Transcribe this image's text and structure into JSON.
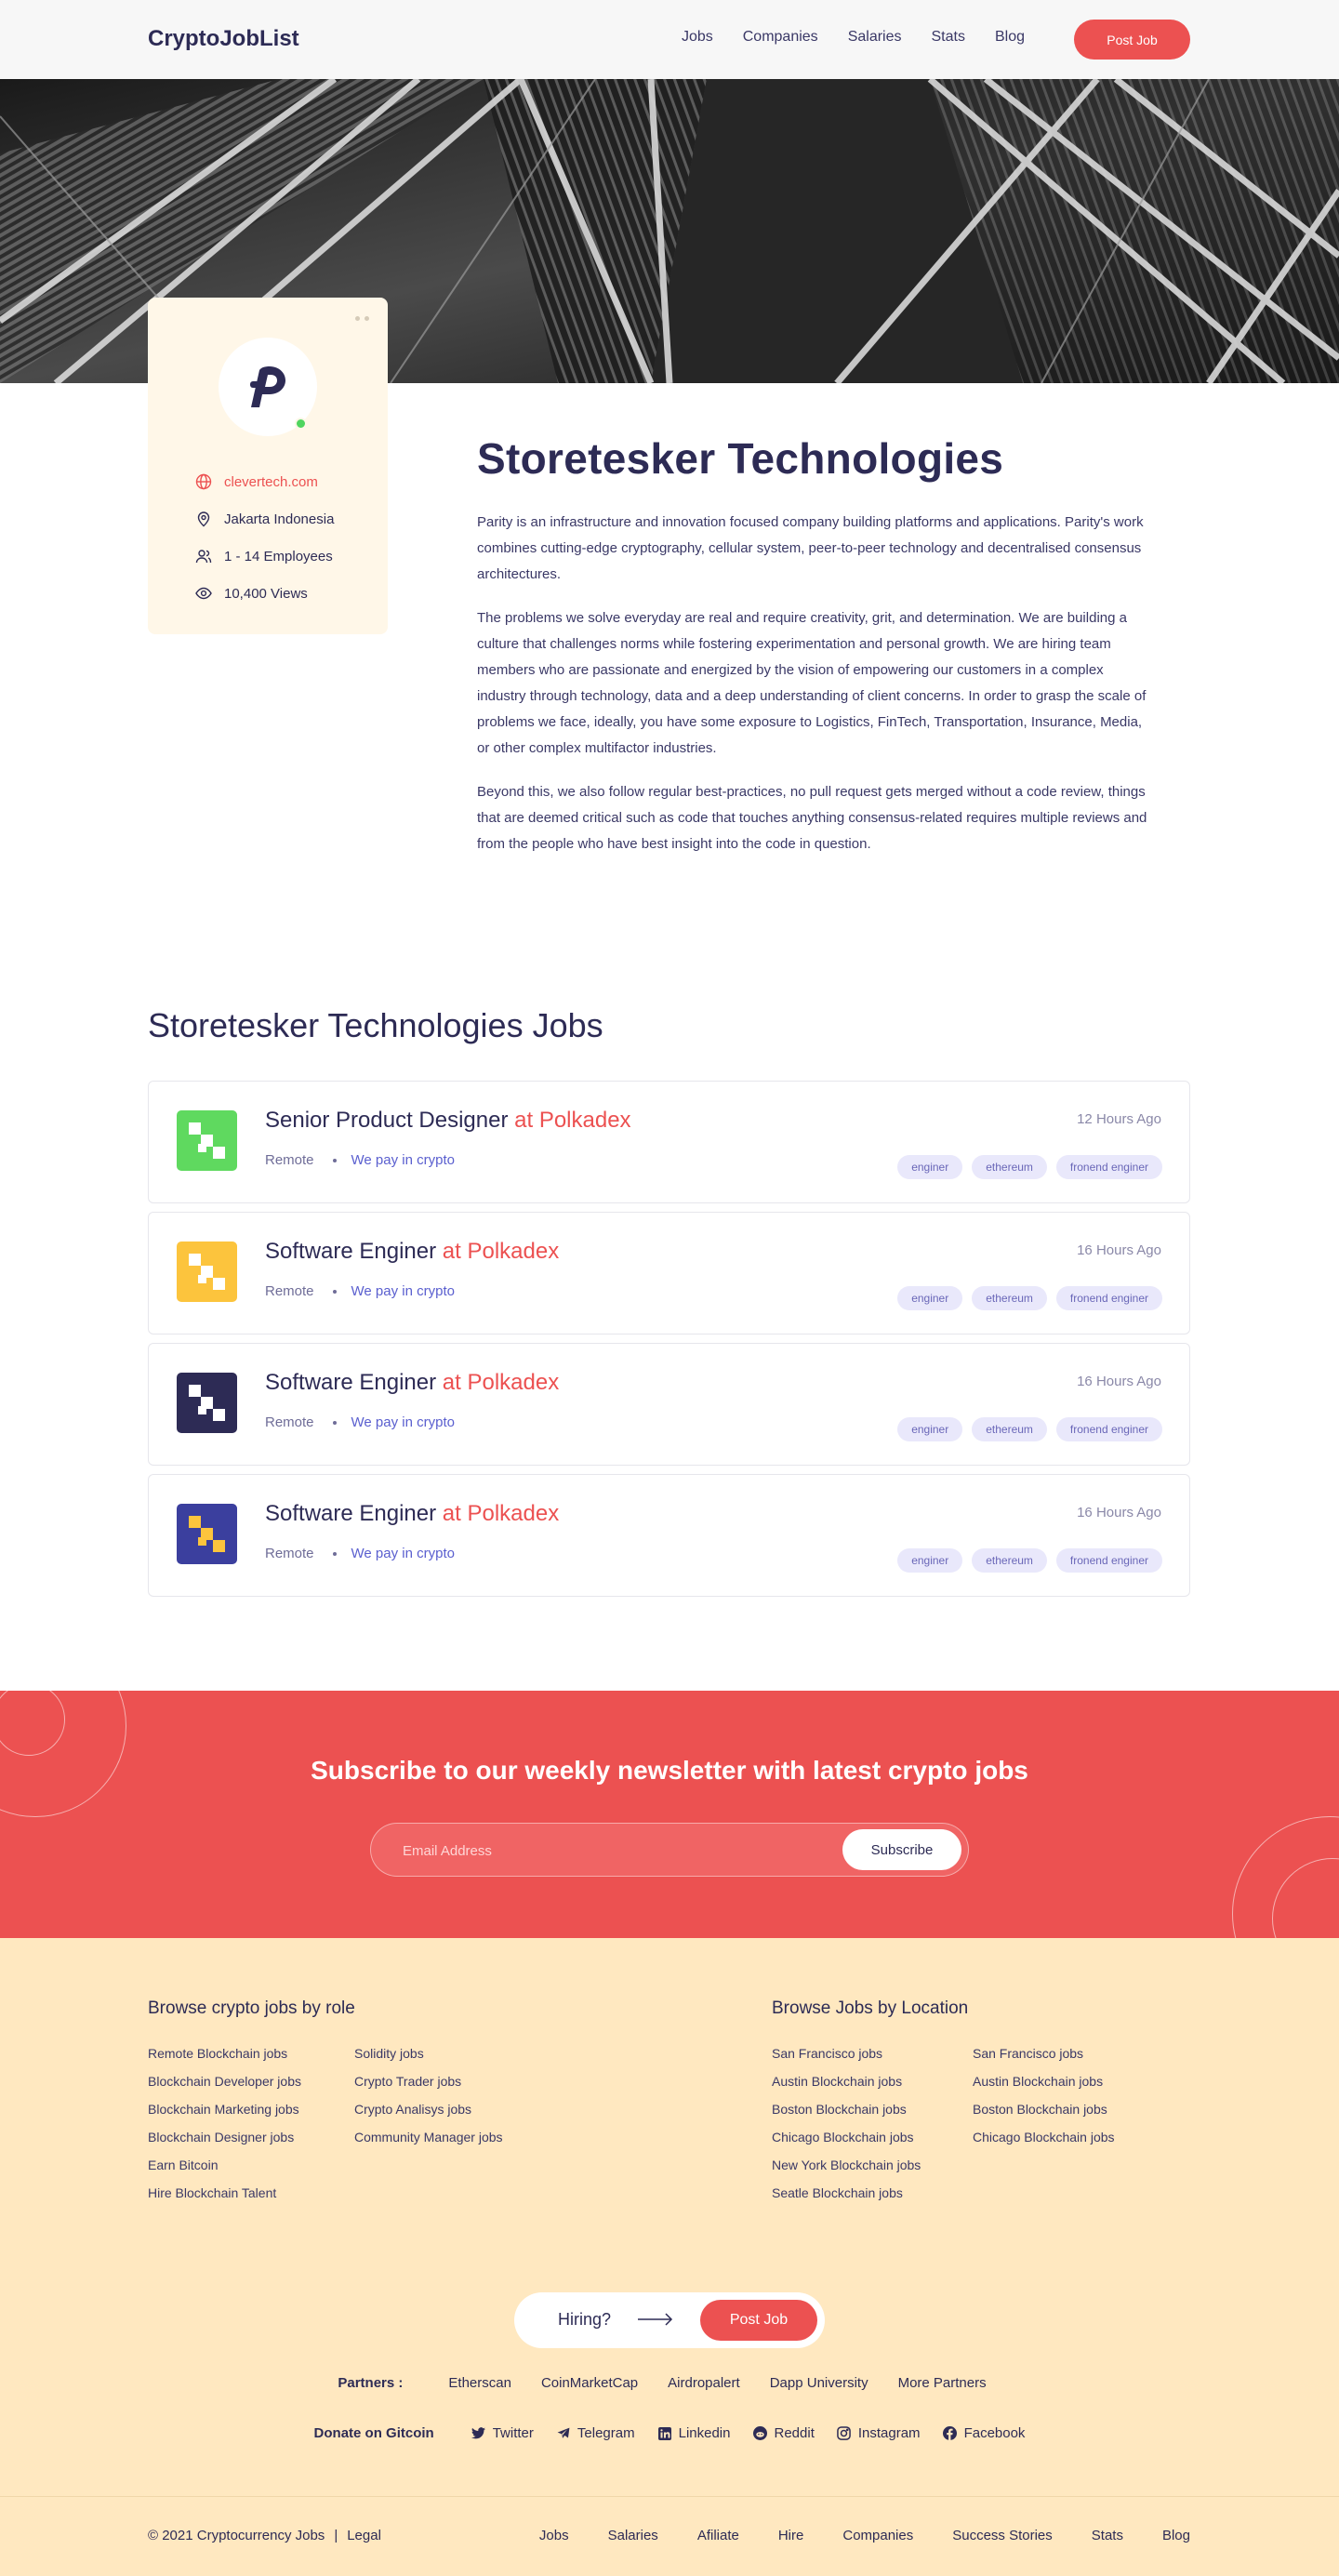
{
  "header": {
    "logo": "CryptoJobList",
    "nav": [
      "Jobs",
      "Companies",
      "Salaries",
      "Stats",
      "Blog"
    ],
    "post_job_label": "Post Job"
  },
  "company": {
    "website": "clevertech.com",
    "location": "Jakarta Indonesia",
    "employees": "1 - 14 Employees",
    "views": "10,400 Views",
    "name": "Storetesker Technologies",
    "about": [
      "Parity is an infrastructure and innovation focused company building platforms and applications. Parity's work combines cutting-edge cryptography, cellular system, peer-to-peer technology and decentralised consensus architectures.",
      "The problems we solve everyday are real and require creativity, grit, and determination. We are building a culture that challenges norms while fostering experimentation and personal growth. We are hiring team members who are passionate and energized by the vision of empowering our customers in a complex industry through technology, data and a deep understanding of client concerns. In order to grasp the scale of problems we face, ideally, you have some exposure to Logistics, FinTech, Transportation, Insurance, Media, or other complex multifactor industries.",
      "Beyond this, we also follow regular best-practices, no pull request gets merged without a code review, things that are deemed critical such as code that touches anything consensus-related requires multiple reviews and from the people who have best insight into the code in question."
    ]
  },
  "jobs": {
    "section_title": "Storetesker Technologies Jobs",
    "items": [
      {
        "title": "Senior Product Designer",
        "at": "at Polkadex",
        "remote": "Remote",
        "pay": "We pay in crypto",
        "time": "12 Hours Ago",
        "tags": [
          "enginer",
          "ethereum",
          "fronend enginer"
        ],
        "icon_bg": "#5fd95f",
        "icon_fg": "#ffffff"
      },
      {
        "title": "Software Enginer",
        "at": "at Polkadex",
        "remote": "Remote",
        "pay": "We pay in crypto",
        "time": "16 Hours Ago",
        "tags": [
          "enginer",
          "ethereum",
          "fronend enginer"
        ],
        "icon_bg": "#fcc43d",
        "icon_fg": "#ffffff"
      },
      {
        "title": "Software Enginer",
        "at": "at Polkadex",
        "remote": "Remote",
        "pay": "We pay in crypto",
        "time": "16 Hours Ago",
        "tags": [
          "enginer",
          "ethereum",
          "fronend enginer"
        ],
        "icon_bg": "#2d2b55",
        "icon_fg": "#ffffff"
      },
      {
        "title": "Software Enginer",
        "at": "at Polkadex",
        "remote": "Remote",
        "pay": "We pay in crypto",
        "time": "16 Hours Ago",
        "tags": [
          "enginer",
          "ethereum",
          "fronend enginer"
        ],
        "icon_bg": "#3b3f9e",
        "icon_fg": "#fcc43d"
      }
    ]
  },
  "newsletter": {
    "title": "Subscribe to our weekly newsletter with latest crypto jobs",
    "placeholder": "Email Address",
    "button": "Subscribe"
  },
  "footer": {
    "roles_title": "Browse crypto jobs by role",
    "roles_col1": [
      "Remote Blockchain jobs",
      "Blockchain Developer jobs",
      "Blockchain Marketing jobs",
      "Blockchain Designer jobs",
      "Earn Bitcoin",
      "Hire Blockchain Talent"
    ],
    "roles_col2": [
      "Solidity jobs",
      "Crypto Trader jobs",
      "Crypto Analisys jobs",
      "Community Manager jobs"
    ],
    "location_title": "Browse Jobs by Location",
    "loc_col1": [
      "San Francisco jobs",
      "Austin Blockchain jobs",
      "Boston Blockchain jobs",
      "Chicago Blockchain jobs",
      "New York Blockchain jobs",
      "Seatle Blockchain jobs"
    ],
    "loc_col2": [
      "San Francisco jobs",
      "Austin Blockchain jobs",
      "Boston Blockchain jobs",
      "Chicago Blockchain jobs"
    ],
    "hiring_label": "Hiring?",
    "hiring_button": "Post Job",
    "partners_label": "Partners :",
    "partners": [
      "Etherscan",
      "CoinMarketCap",
      "Airdropalert",
      "Dapp University",
      "More Partners"
    ],
    "donate": "Donate on Gitcoin",
    "socials": [
      {
        "label": "Twitter",
        "icon": "twitter-icon"
      },
      {
        "label": "Telegram",
        "icon": "telegram-icon"
      },
      {
        "label": "Linkedin",
        "icon": "linkedin-icon"
      },
      {
        "label": "Reddit",
        "icon": "reddit-icon"
      },
      {
        "label": "Instagram",
        "icon": "instagram-icon"
      },
      {
        "label": "Facebook",
        "icon": "facebook-icon"
      }
    ],
    "copyright": "© 2021 Cryptocurrency Jobs",
    "legal": "Legal",
    "bottom_nav": [
      "Jobs",
      "Salaries",
      "Afiliate",
      "Hire",
      "Companies",
      "Success Stories",
      "Stats",
      "Blog"
    ]
  },
  "colors": {
    "accent": "#ec5151",
    "navy": "#2d2b55",
    "cream": "#ffe8c0"
  }
}
